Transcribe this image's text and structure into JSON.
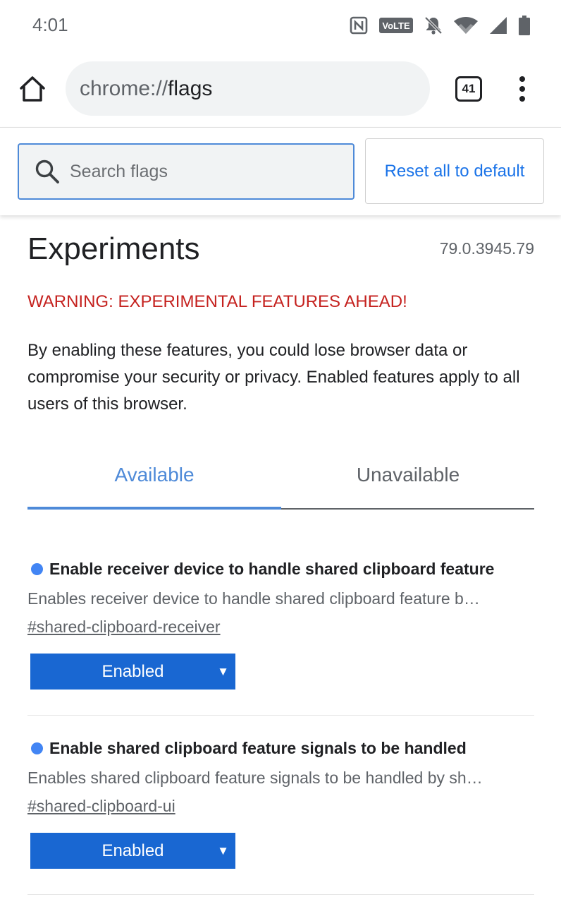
{
  "status_bar": {
    "time": "4:01",
    "icons": [
      "nfc-icon",
      "volte-icon",
      "notifications-off-icon",
      "wifi-icon",
      "signal-icon",
      "battery-icon"
    ],
    "volte_label": "VoLTE"
  },
  "toolbar": {
    "url_scheme": "chrome://",
    "url_host": "flags",
    "tab_count": "41"
  },
  "search": {
    "placeholder": "Search flags",
    "value": "",
    "reset_label": "Reset all to default"
  },
  "page": {
    "title": "Experiments",
    "version": "79.0.3945.79",
    "warning": "WARNING: EXPERIMENTAL FEATURES AHEAD!",
    "intro": "By enabling these features, you could lose browser data or compromise your security or privacy. Enabled features apply to all users of this browser."
  },
  "tabs": [
    {
      "label": "Available",
      "selected": true
    },
    {
      "label": "Unavailable",
      "selected": false
    }
  ],
  "experiments": [
    {
      "title": "Enable receiver device to handle shared clipboard feature",
      "description": "Enables receiver device to handle shared clipboard feature b…",
      "link": "#shared-clipboard-receiver",
      "state": "Enabled"
    },
    {
      "title": "Enable shared clipboard feature signals to be handled",
      "description": "Enables shared clipboard feature signals to be handled by sh…",
      "link": "#shared-clipboard-ui",
      "state": "Enabled"
    }
  ],
  "colors": {
    "accent": "#4e8ad8",
    "link_blue": "#1a73e8",
    "select_blue": "#1967d2",
    "warning_red": "#c5221f",
    "dot_blue": "#4285f4"
  }
}
